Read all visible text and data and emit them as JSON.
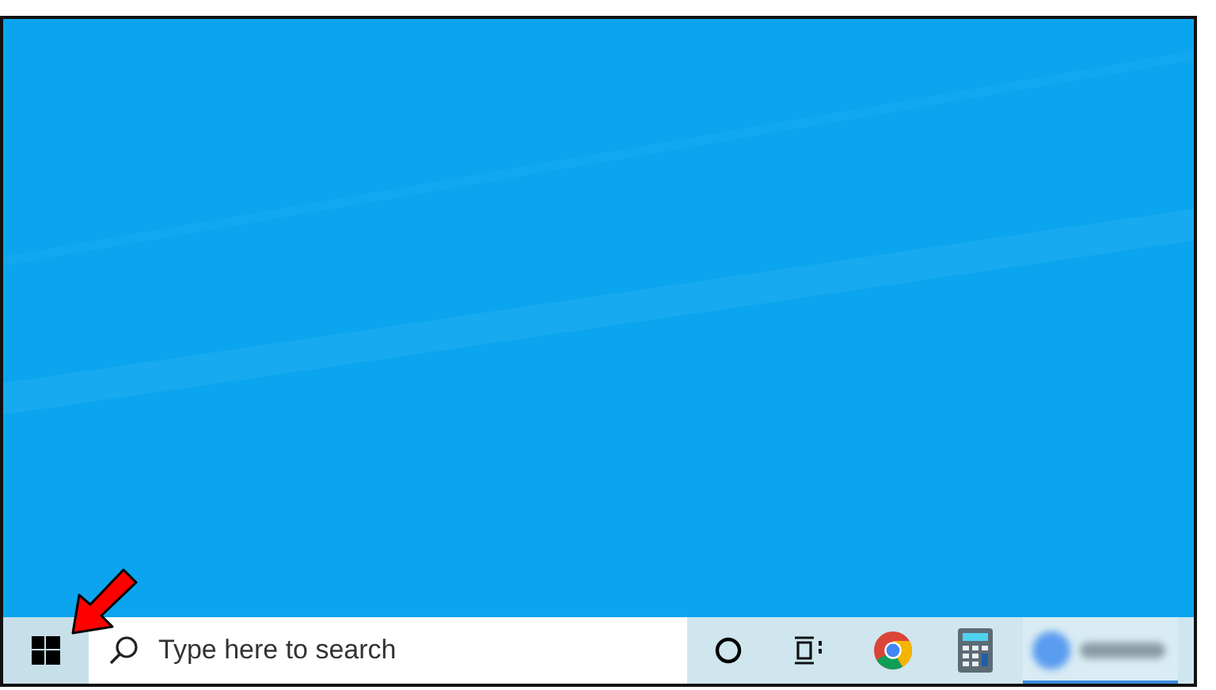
{
  "taskbar": {
    "start": {
      "annotated": true
    },
    "search": {
      "placeholder": "Type here to search"
    },
    "items": [
      {
        "kind": "cortana",
        "running": false
      },
      {
        "kind": "task-view",
        "running": false
      },
      {
        "kind": "chrome",
        "running": false
      },
      {
        "kind": "calculator",
        "running": false
      },
      {
        "kind": "blurred-app",
        "running": true
      }
    ]
  }
}
